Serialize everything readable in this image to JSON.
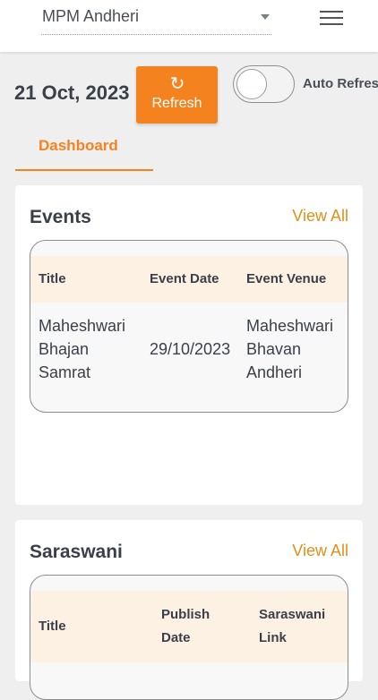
{
  "header": {
    "branch": "MPM Andheri"
  },
  "toolbar": {
    "date": "21 Oct, 2023",
    "refresh_label": "Refresh",
    "auto_refresh_label": "Auto Refresh",
    "auto_refresh_on": false
  },
  "tabs": [
    {
      "label": "Dashboard",
      "active": true
    }
  ],
  "events": {
    "title": "Events",
    "view_all": "View All",
    "columns": [
      "Title",
      "Event Date",
      "Event Venue"
    ],
    "rows": [
      {
        "title": [
          "Maheshwari",
          "Bhajan",
          "Samrat"
        ],
        "date": "29/10/2023",
        "venue": [
          "Maheshwari",
          "Bhavan",
          "Andheri"
        ]
      }
    ]
  },
  "saraswani": {
    "title": "Saraswani",
    "view_all": "View All",
    "columns": [
      [
        "Title"
      ],
      [
        "Publish",
        "Date"
      ],
      [
        "Saraswani",
        "Link"
      ]
    ]
  },
  "colors": {
    "accent": "#f4831f",
    "view_all": "#e0901b",
    "table_header_bg": "#fdf1e4",
    "page_bg": "#efefef"
  }
}
